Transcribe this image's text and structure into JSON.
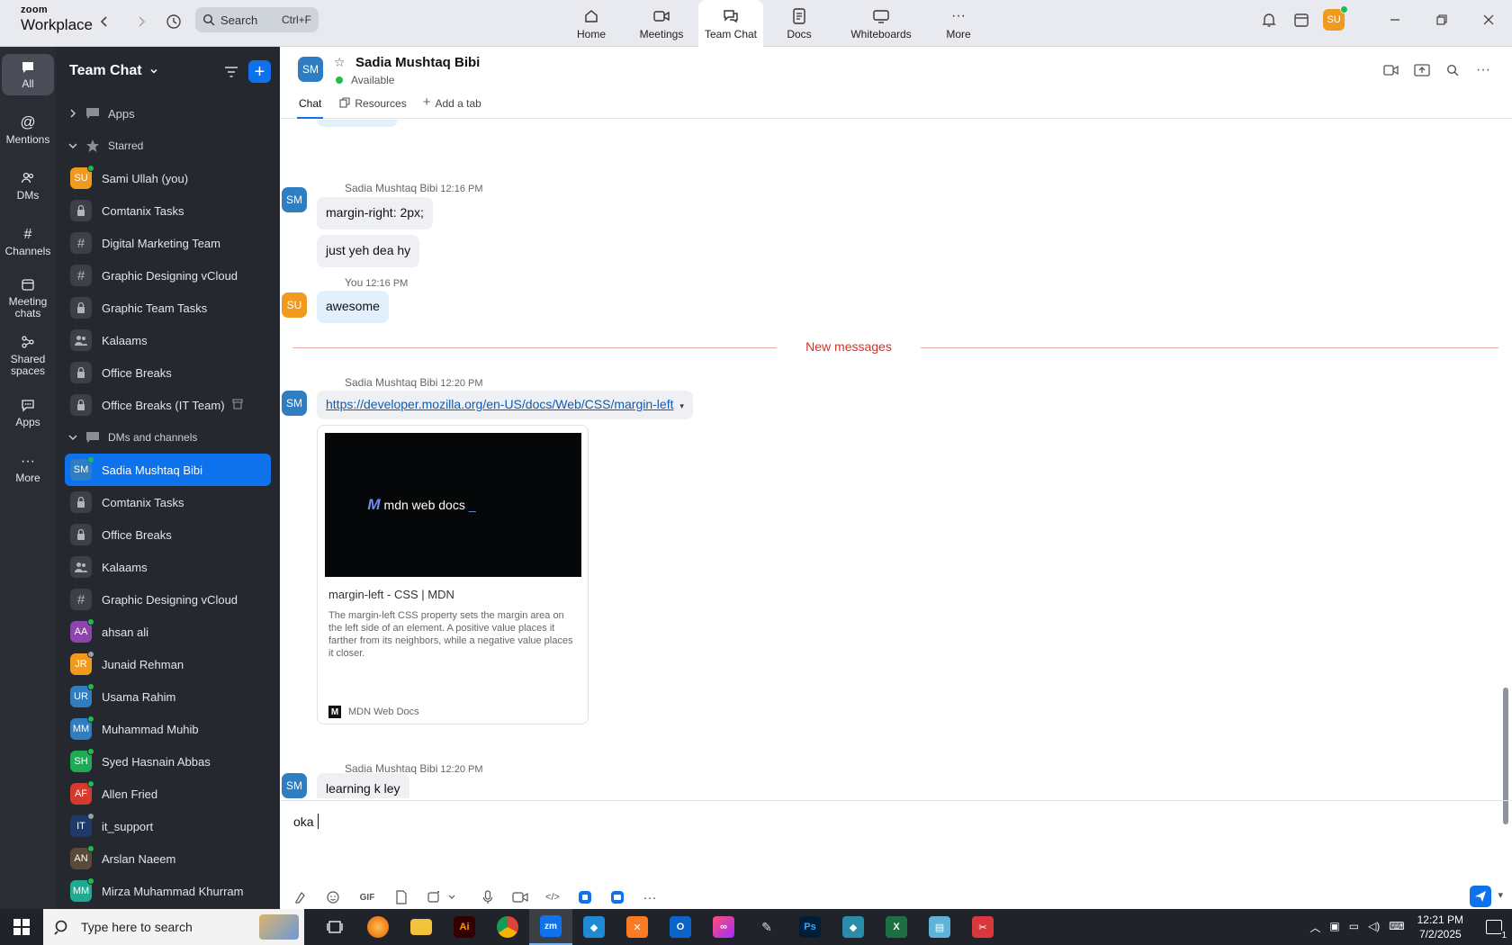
{
  "app": {
    "logo_top": "zoom",
    "logo_bottom": "Workplace",
    "search_placeholder": "Search",
    "search_shortcut": "Ctrl+F",
    "user_initials": "SU",
    "nav": [
      {
        "label": "Home",
        "icon": "home-icon"
      },
      {
        "label": "Meetings",
        "icon": "video-icon"
      },
      {
        "label": "Team Chat",
        "icon": "chat-icon"
      },
      {
        "label": "Docs",
        "icon": "doc-icon"
      },
      {
        "label": "Whiteboards",
        "icon": "whiteboard-icon"
      },
      {
        "label": "More",
        "icon": "more-dots-icon"
      }
    ],
    "active_nav": "Team Chat"
  },
  "rail": [
    {
      "label": "All",
      "icon": "chat-bubble-icon"
    },
    {
      "label": "Mentions",
      "icon": "at-icon"
    },
    {
      "label": "DMs",
      "icon": "people-icon"
    },
    {
      "label": "Channels",
      "icon": "hash-icon"
    },
    {
      "label": "Meeting chats",
      "icon": "calendar-icon"
    },
    {
      "label": "Shared spaces",
      "icon": "shared-icon"
    },
    {
      "label": "Apps",
      "icon": "apps-icon"
    },
    {
      "label": "More",
      "icon": "more-dots-icon"
    }
  ],
  "sidebar": {
    "title": "Team Chat",
    "sections": {
      "apps": "Apps",
      "starred": "Starred",
      "dms": "DMs and channels"
    },
    "starred": [
      {
        "name": "Sami Ullah (you)",
        "type": "avatar",
        "initials": "SU",
        "color": "#f29a1e",
        "presence": "online"
      },
      {
        "name": "Comtanix Tasks",
        "type": "lock"
      },
      {
        "name": "Digital Marketing Team",
        "type": "hash"
      },
      {
        "name": "Graphic Designing vCloud",
        "type": "hash"
      },
      {
        "name": "Graphic Team Tasks",
        "type": "lock"
      },
      {
        "name": "Kalaams",
        "type": "group"
      },
      {
        "name": "Office Breaks",
        "type": "lock"
      },
      {
        "name": "Office Breaks (IT Team)",
        "type": "lock",
        "extra": "archive-icon"
      }
    ],
    "dms": [
      {
        "name": "Sadia Mushtaq Bibi",
        "type": "avatar",
        "initials": "SM",
        "color": "#2f7ec1",
        "presence": "online",
        "selected": true
      },
      {
        "name": "Comtanix Tasks",
        "type": "lock"
      },
      {
        "name": "Office Breaks",
        "type": "lock"
      },
      {
        "name": "Kalaams",
        "type": "group"
      },
      {
        "name": "Graphic Designing vCloud",
        "type": "hash"
      },
      {
        "name": "ahsan ali",
        "type": "avatar",
        "initials": "AA",
        "color": "#8e44ad",
        "presence": "online"
      },
      {
        "name": "Junaid Rehman",
        "type": "avatar",
        "initials": "JR",
        "color": "#f29a1e",
        "presence": "away"
      },
      {
        "name": "Usama Rahim",
        "type": "avatar",
        "initials": "UR",
        "color": "#2f7ec1",
        "presence": "busy"
      },
      {
        "name": "Muhammad Muhib",
        "type": "avatar",
        "initials": "MM",
        "color": "#2f7ec1",
        "presence": "online"
      },
      {
        "name": "Syed Hasnain Abbas",
        "type": "avatar",
        "initials": "SH",
        "color": "#1eab58",
        "presence": "online"
      },
      {
        "name": "Allen Fried",
        "type": "avatar",
        "initials": "AF",
        "color": "#d63a2f",
        "presence": "online"
      },
      {
        "name": "it_support",
        "type": "avatar",
        "initials": "IT",
        "color": "#1d3a6b",
        "presence": "away"
      },
      {
        "name": "Arslan Naeem",
        "type": "avatar",
        "initials": "AN",
        "color": "#5a4a3a",
        "presence": "online"
      },
      {
        "name": "Mirza Muhammad Khurram",
        "type": "avatar",
        "initials": "MM",
        "color": "#1eab8f",
        "presence": "online"
      }
    ]
  },
  "chat": {
    "contact_name": "Sadia Mushtaq Bibi",
    "contact_initials": "SM",
    "contact_status": "Available",
    "tabs": [
      "Chat",
      "Resources",
      "Add a tab"
    ],
    "messages": [
      {
        "sender": "Sadia Mushtaq Bibi",
        "time": "12:16 PM",
        "lines": [
          "margin-right: 2px;",
          "just yeh dea hy"
        ]
      },
      {
        "sender": "You",
        "time": "12:16 PM",
        "lines": [
          "awesome"
        ]
      },
      {
        "sender": "Sadia Mushtaq Bibi",
        "time": "12:20 PM",
        "link": "https://developer.mozilla.org/en-US/docs/Web/CSS/margin-left"
      },
      {
        "sender": "Sadia Mushtaq Bibi",
        "time": "12:20 PM",
        "lines": [
          "learning k ley"
        ]
      }
    ],
    "new_messages_label": "New messages",
    "preview": {
      "logo_text": "mdn web docs",
      "title": "margin-left - CSS | MDN",
      "description": "The margin-left CSS property sets the margin area on the left side of an element. A positive value places it farther from its neighbors, while a negative value places it closer.",
      "source": "MDN Web Docs"
    },
    "composer_text": "oka"
  },
  "taskbar": {
    "search_placeholder": "Type here to search",
    "time": "12:21 PM",
    "date": "7/2/2025",
    "notification_count": "1"
  }
}
